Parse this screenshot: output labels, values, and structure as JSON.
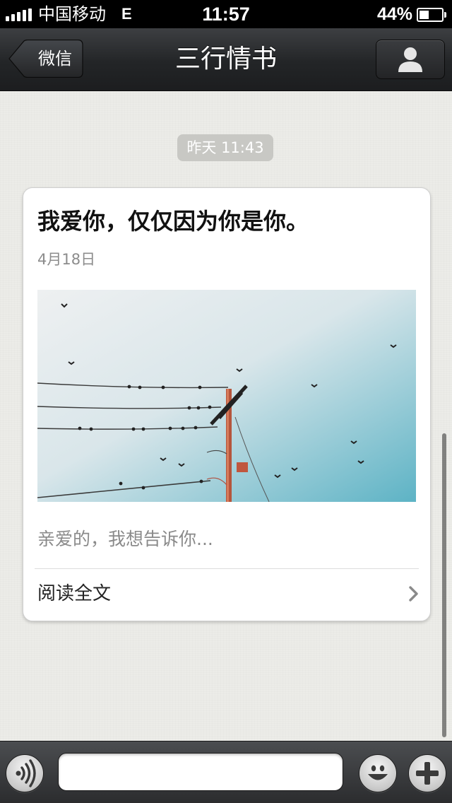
{
  "status_bar": {
    "carrier": "中国移动",
    "network": "E",
    "time": "11:57",
    "battery_percent_label": "44%",
    "battery_level": 0.44,
    "signal_bars": 5
  },
  "nav": {
    "back_label": "微信",
    "title": "三行情书",
    "profile_icon": "person-icon"
  },
  "chat": {
    "timestamp": "昨天 11:43",
    "article": {
      "title": "我爱你，仅仅因为你是你。",
      "date": "4月18日",
      "image_icon": "power-line-birds-photo",
      "summary": "亲爱的，我想告诉你...",
      "read_more": "阅读全文",
      "read_more_icon": "chevron-right-icon"
    }
  },
  "input_bar": {
    "voice_icon": "voice-icon",
    "message_placeholder": "",
    "emoji_icon": "smiley-icon",
    "more_icon": "plus-icon"
  },
  "colors": {
    "nav_bg": "#232527",
    "chat_bg": "#ecece8",
    "timestamp_bg": "#c8c8c4",
    "sky_top": "#eceef0",
    "sky_bottom": "#5fb4c6"
  }
}
